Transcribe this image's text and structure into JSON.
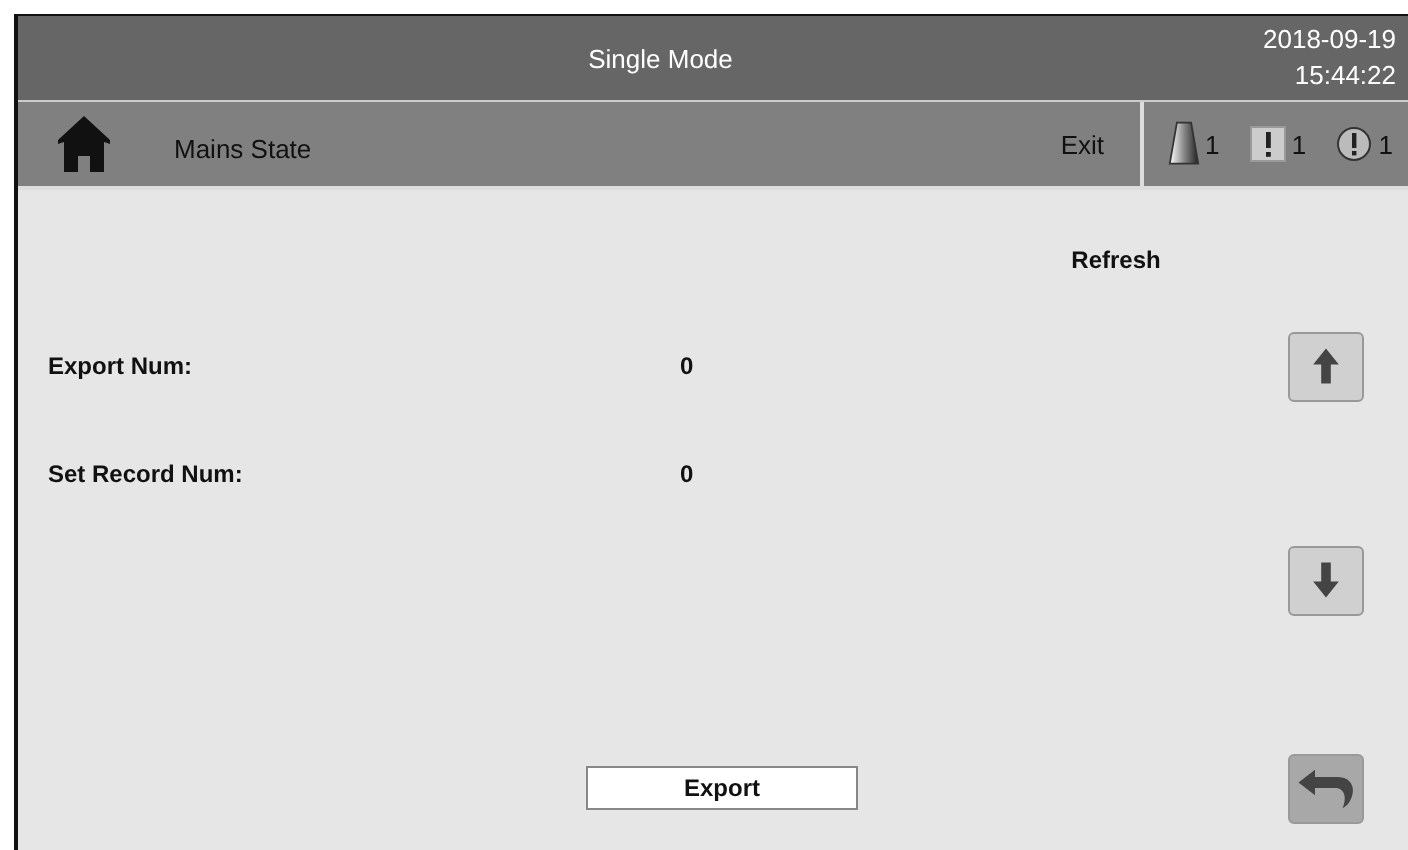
{
  "header": {
    "title": "Single Mode",
    "date": "2018-09-19",
    "time": "15:44:22"
  },
  "nav": {
    "title": "Mains State",
    "exit": "Exit"
  },
  "status": [
    {
      "kind": "beacon",
      "count": "1"
    },
    {
      "kind": "square-alert",
      "count": "1"
    },
    {
      "kind": "round-alert",
      "count": "1"
    }
  ],
  "refresh": "Refresh",
  "fields": [
    {
      "label": "Export Num:",
      "value": "0"
    },
    {
      "label": "Set Record Num:",
      "value": "0"
    }
  ],
  "export_button": "Export"
}
